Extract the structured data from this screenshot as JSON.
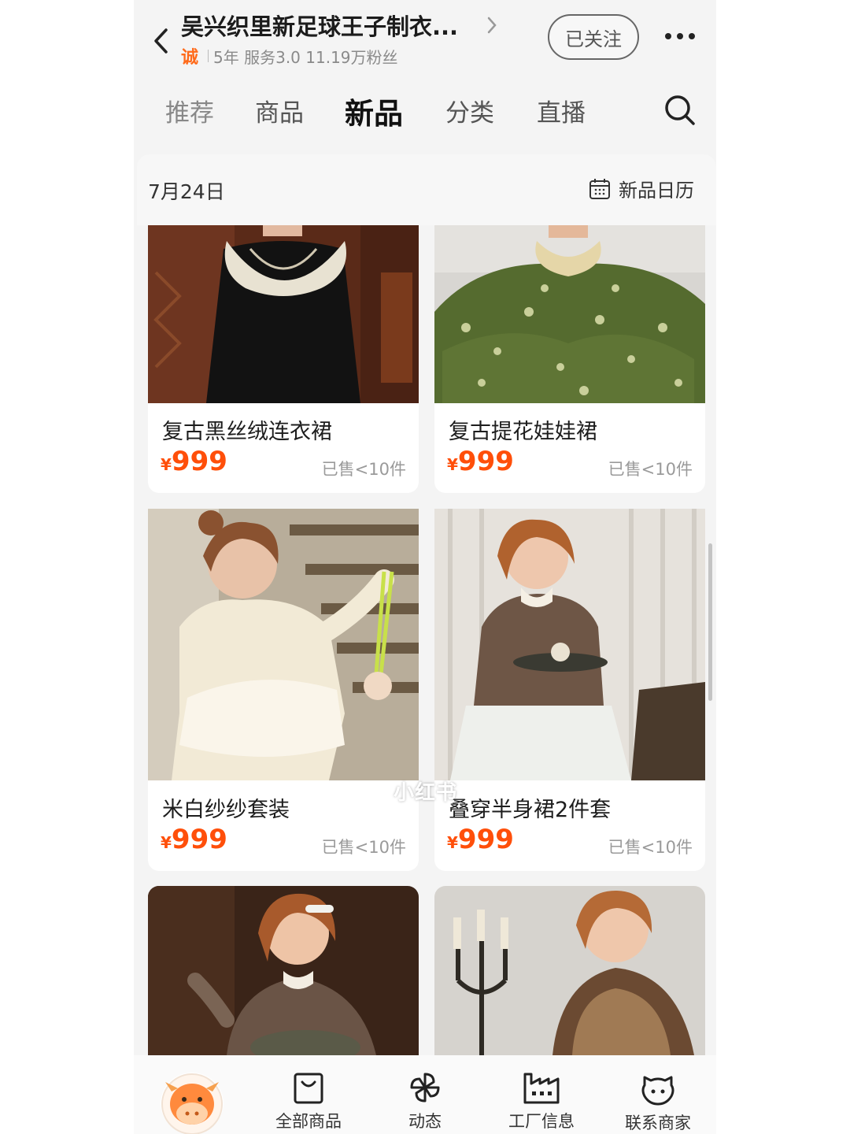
{
  "header": {
    "shop_name": "吴兴织里新足球王子制衣...",
    "badge": "诚",
    "meta": "5年 服务3.0 11.19万粉丝",
    "follow_label": "已关注"
  },
  "tabs": [
    {
      "label": "推荐"
    },
    {
      "label": "商品"
    },
    {
      "label": "新品",
      "active": true
    },
    {
      "label": "分类"
    },
    {
      "label": "直播"
    }
  ],
  "datebar": {
    "date": "7月24日",
    "calendar_label": "新品日历"
  },
  "products": [
    {
      "name": "复古黑丝绒连衣裙",
      "currency": "¥",
      "price": "999",
      "sold": "已售<10件"
    },
    {
      "name": "复古提花娃娃裙",
      "currency": "¥",
      "price": "999",
      "sold": "已售<10件"
    },
    {
      "name": "米白纱纱套装",
      "currency": "¥",
      "price": "999",
      "sold": "已售<10件"
    },
    {
      "name": "叠穿半身裙2件套",
      "currency": "¥",
      "price": "999",
      "sold": "已售<10件"
    }
  ],
  "watermark": "小红书",
  "bottom_nav": [
    {
      "label": "全部商品",
      "icon": "bag-icon"
    },
    {
      "label": "动态",
      "icon": "pinwheel-icon"
    },
    {
      "label": "工厂信息",
      "icon": "factory-icon"
    },
    {
      "label": "联系商家",
      "icon": "chat-bubble-icon"
    }
  ],
  "colors": {
    "price": "#ff4f0a",
    "badge": "#ff6a1a",
    "mascot": "#ff8a3d"
  }
}
